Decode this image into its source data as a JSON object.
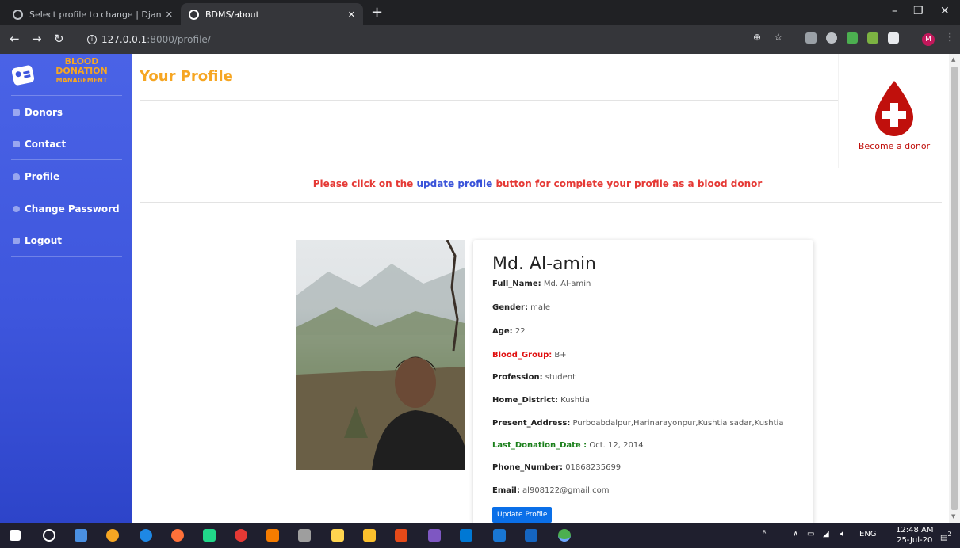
{
  "browser": {
    "tabs": [
      {
        "title": "Select profile to change | Django",
        "active": false
      },
      {
        "title": "BDMS/about",
        "active": true
      }
    ],
    "url_host": "127.0.0.1",
    "url_rest": ":8000/profile/"
  },
  "sidebar": {
    "brand": {
      "line1": "BLOOD",
      "line2": "DONATION",
      "line3": "MANAGEMENT"
    },
    "items": [
      {
        "label": "Donors",
        "icon": "users-icon"
      },
      {
        "label": "Contact",
        "icon": "envelope-icon"
      },
      {
        "label": "Profile",
        "icon": "user-icon"
      },
      {
        "label": "Change Password",
        "icon": "key-icon"
      },
      {
        "label": "Logout",
        "icon": "sign-out-icon"
      }
    ]
  },
  "main": {
    "title": "Your Profile",
    "notice": {
      "before": "Please click on the",
      "link": "update profile",
      "after": "button for complete your profile as a blood donor"
    },
    "become_donor": "Become a donor"
  },
  "profile": {
    "name": "Md. Al-amin",
    "fields": [
      {
        "label": "Full_Name:",
        "value": "Md. Al-amin"
      },
      {
        "label": "Gender:",
        "value": "male"
      },
      {
        "label": "Age:",
        "value": "22"
      },
      {
        "label": "Blood_Group:",
        "value": "B+"
      },
      {
        "label": "Profession:",
        "value": "student"
      },
      {
        "label": "Home_District:",
        "value": "Kushtia"
      },
      {
        "label": "Present_Address:",
        "value": "Purboabdalpur,Harinarayonpur,Kushtia sadar,Kushtia"
      },
      {
        "label": "Last_Donation_Date :",
        "value": "Oct. 12, 2014"
      },
      {
        "label": "Phone_Number:",
        "value": "01868235699"
      },
      {
        "label": "Email:",
        "value": "al908122@gmail.com"
      }
    ],
    "update_button": "Update Profile"
  },
  "taskbar": {
    "language": "ENG",
    "time": "12:48 AM",
    "date": "25-Jul-20",
    "notification_count": "2"
  },
  "colors": {
    "sidebar": "#3e56dd",
    "accent_orange": "#f6a623",
    "notice_red": "#e53935",
    "link_blue": "#3a53d9",
    "button_blue": "#0a6fe8",
    "donor_red": "#c0100c"
  }
}
